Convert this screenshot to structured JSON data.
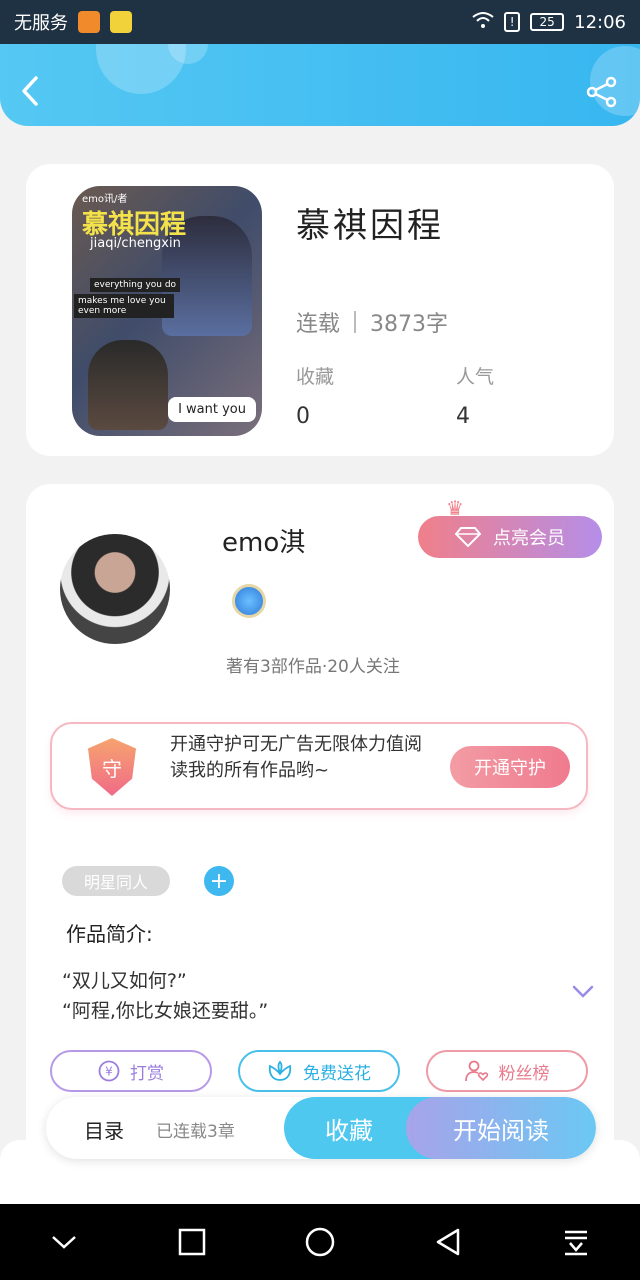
{
  "status_bar": {
    "carrier": "无服务",
    "battery": "25",
    "time": "12:06"
  },
  "book": {
    "title": "慕祺因程",
    "status": "连载",
    "word_count": "3873字",
    "favorites_label": "收藏",
    "favorites_value": "0",
    "popularity_label": "人气",
    "popularity_value": "4",
    "cover": {
      "tag": "emo讯/者",
      "title": "慕祺因程",
      "subtitle": "jiaqi/chengxin",
      "line1": "everything you do",
      "line2": "makes me love you even more",
      "bubble": "I want you"
    }
  },
  "author": {
    "name": "emo淇",
    "vip_button": "点亮会员",
    "meta": "著有3部作品·20人关注"
  },
  "guard": {
    "icon_char": "守",
    "text": "开通守护可无广告无限体力值阅读我的所有作品哟~",
    "button": "开通守护"
  },
  "tags": [
    "明星同人"
  ],
  "intro": {
    "label": "作品简介:",
    "lines": [
      "“双儿又如何?”",
      "“阿程,你比女娘还要甜。”"
    ]
  },
  "actions": {
    "reward": "打赏",
    "flower": "免费送花",
    "fans": "粉丝榜"
  },
  "bottom": {
    "catalog": "目录",
    "progress": "已连载3章",
    "collect": "收藏",
    "start_reading": "开始阅读"
  },
  "colors": {
    "header": "#37b6f0",
    "accent_blue": "#4fc8f0",
    "vip_gradient_start": "#f07f8a",
    "vip_gradient_end": "#b58ee8"
  }
}
